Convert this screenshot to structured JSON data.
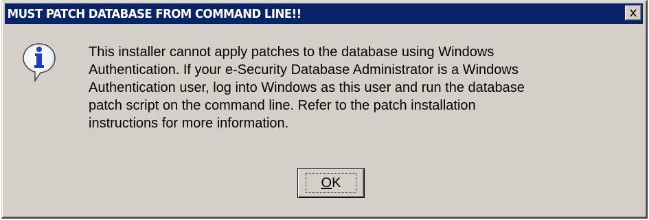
{
  "window": {
    "title": "MUST PATCH DATABASE FROM COMMAND LINE!!",
    "close_icon": "close-icon"
  },
  "message": {
    "icon": "info-icon",
    "text": "This installer cannot apply patches to the database using Windows\nAuthentication. If your e-Security Database Administrator is a Windows\nAuthentication user, log into Windows as this user and run the database\npatch script on the command line.  Refer to the patch installation\ninstructions for more information."
  },
  "buttons": {
    "ok_label": "OK"
  },
  "colors": {
    "titlebar": "#0a246a",
    "face": "#d4d0c8"
  }
}
